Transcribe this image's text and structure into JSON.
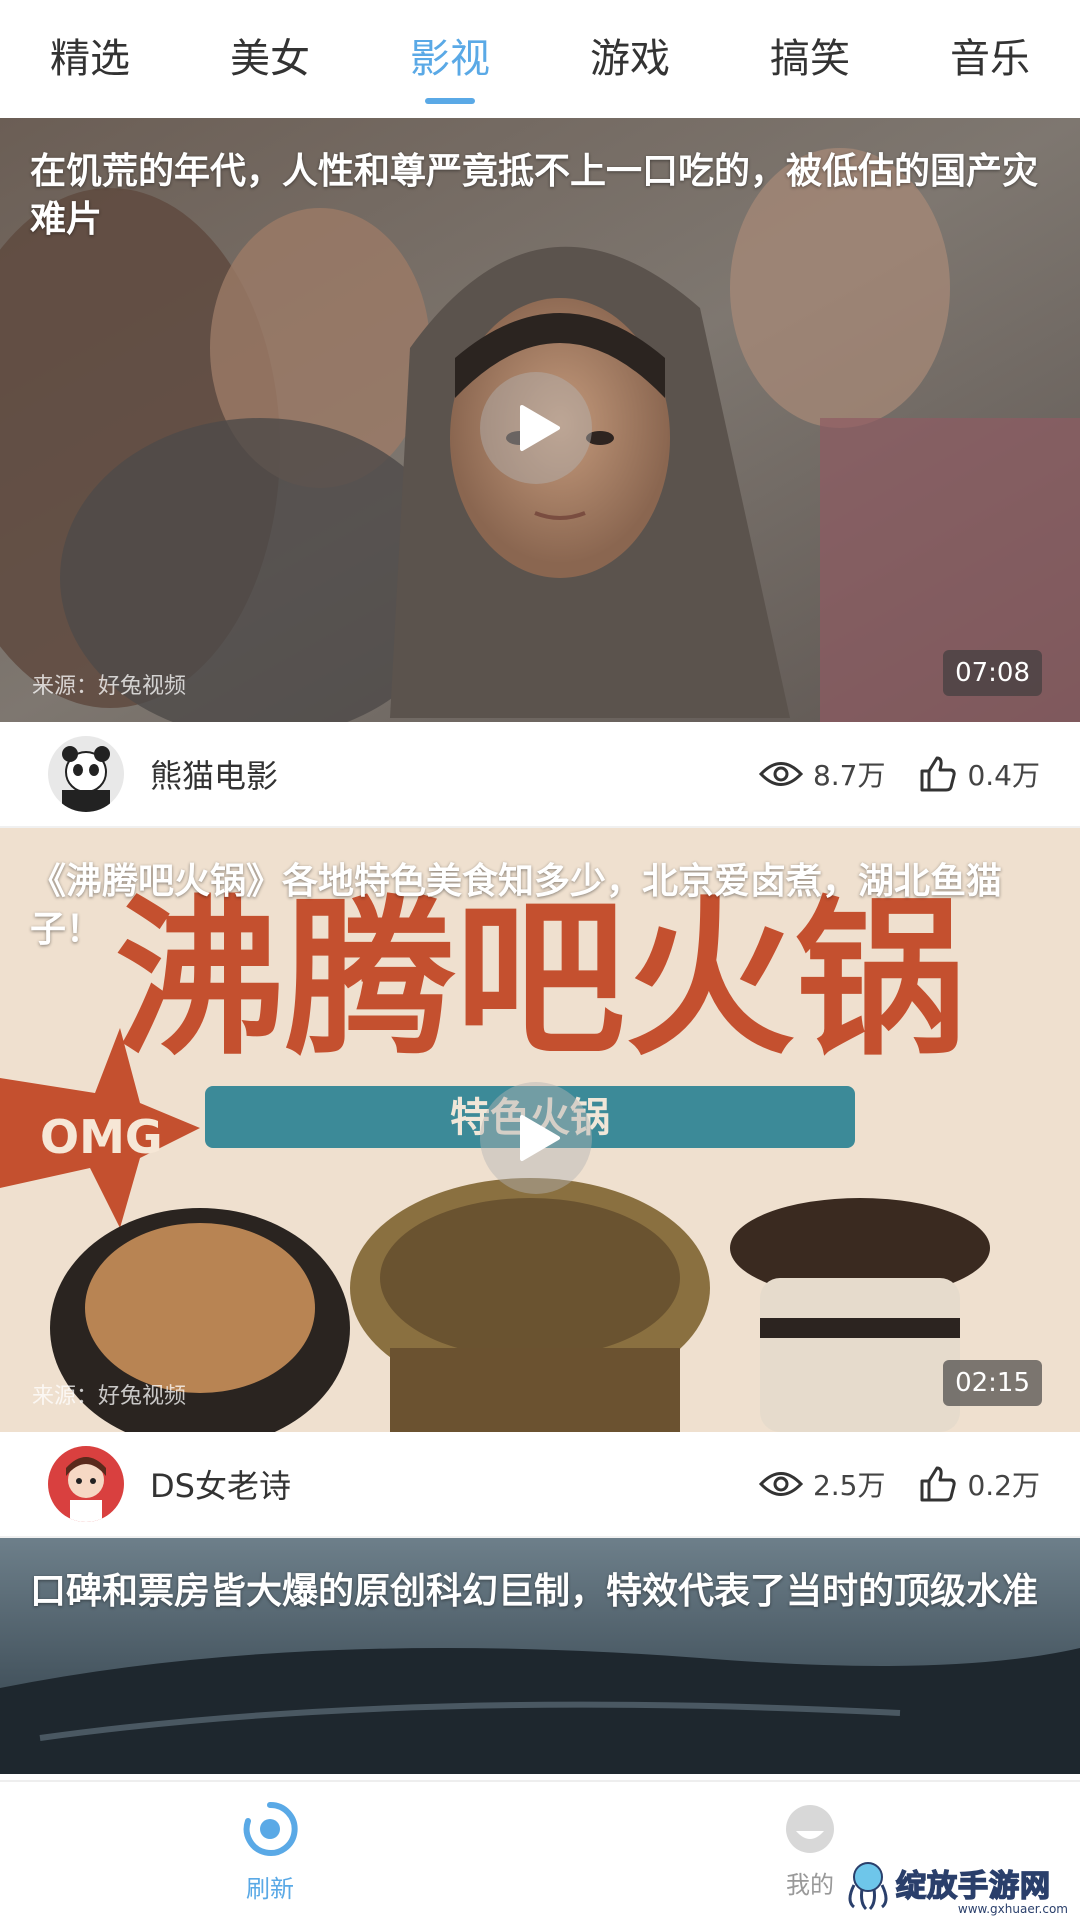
{
  "tabs": [
    {
      "label": "精选",
      "active": false
    },
    {
      "label": "美女",
      "active": false
    },
    {
      "label": "影视",
      "active": true
    },
    {
      "label": "游戏",
      "active": false
    },
    {
      "label": "搞笑",
      "active": false
    },
    {
      "label": "音乐",
      "active": false
    }
  ],
  "cards": [
    {
      "title": "在饥荒的年代，人性和尊严竟抵不上一口吃的，被低估的国产灾难片",
      "source": "来源：好兔视频",
      "duration": "07:08",
      "author": "熊猫电影",
      "views": "8.7万",
      "likes": "0.4万"
    },
    {
      "title": "《沸腾吧火锅》各地特色美食知多少，北京爱卤煮，湖北鱼猫子！",
      "source": "来源：好兔视频",
      "duration": "02:15",
      "author": "DS女老诗",
      "views": "2.5万",
      "likes": "0.2万",
      "poster_text": {
        "big": "沸腾吧火锅",
        "banner": "特色火锅",
        "badge": "OMG"
      }
    },
    {
      "title": "口碑和票房皆大爆的原创科幻巨制，特效代表了当时的顶级水准"
    }
  ],
  "bottom_nav": {
    "refresh_label": "刷新",
    "mine_label": "我的"
  },
  "watermark": {
    "text": "绽放手游网",
    "url": "www.gxhuaer.com"
  },
  "colors": {
    "accent": "#5aa9e6",
    "text": "#333333"
  },
  "icons": [
    "play-icon",
    "eye-icon",
    "thumbs-up-icon",
    "refresh-icon",
    "profile-icon"
  ]
}
